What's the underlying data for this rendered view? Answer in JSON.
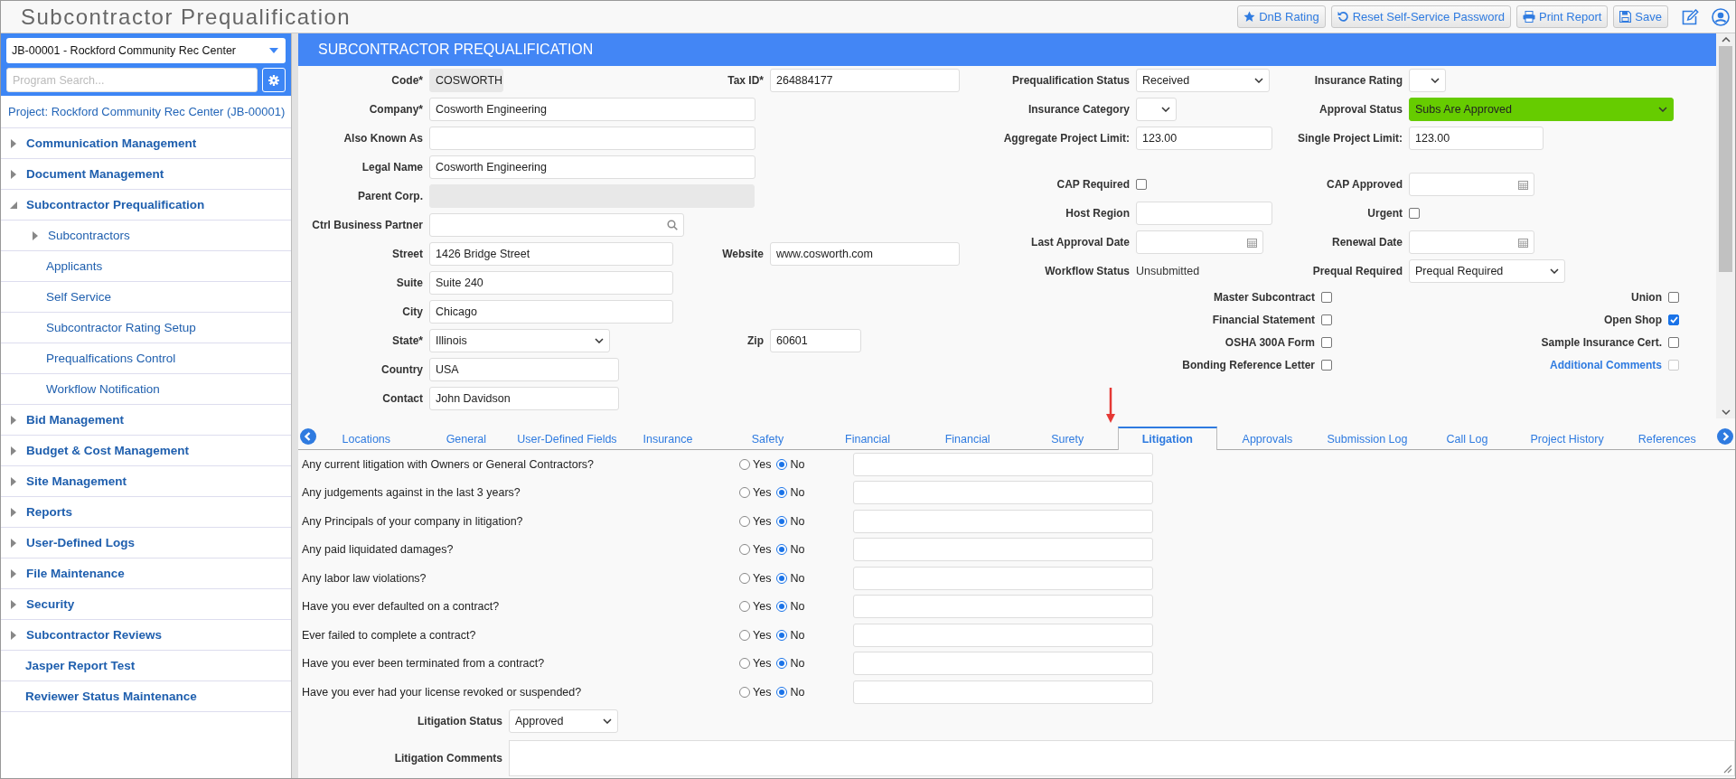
{
  "header": {
    "title": "Subcontractor Prequalification",
    "buttons": [
      {
        "label": "DnB Rating",
        "kind": "star"
      },
      {
        "label": "Reset Self-Service Password",
        "kind": "reset"
      },
      {
        "label": "Print Report",
        "kind": "print"
      },
      {
        "label": "Save",
        "kind": "save"
      }
    ],
    "tools": [
      {
        "kind": "edit"
      },
      {
        "kind": "user"
      }
    ]
  },
  "sidebar": {
    "project_select": "JB-00001 - Rockford Community Rec Center",
    "search": {
      "placeholder": "Program Search..."
    },
    "project_link": "Project: Rockford Community Rec Center (JB-00001)",
    "items": [
      {
        "label": "Communication Management",
        "kind": "group",
        "expanded": false
      },
      {
        "label": "Document Management",
        "kind": "group",
        "expanded": false
      },
      {
        "label": "Subcontractor Prequalification",
        "kind": "group",
        "expanded": true,
        "children": [
          {
            "label": "Subcontractors",
            "kind": "group",
            "expanded": false
          },
          {
            "label": "Applicants",
            "kind": "link"
          },
          {
            "label": "Self Service",
            "kind": "link"
          },
          {
            "label": "Subcontractor Rating Setup",
            "kind": "link"
          },
          {
            "label": "Prequalfications Control",
            "kind": "link"
          },
          {
            "label": "Workflow Notification",
            "kind": "link"
          }
        ]
      },
      {
        "label": "Bid Management",
        "kind": "group",
        "expanded": false
      },
      {
        "label": "Budget & Cost Management",
        "kind": "group",
        "expanded": false
      },
      {
        "label": "Site Management",
        "kind": "group",
        "expanded": false
      },
      {
        "label": "Reports",
        "kind": "group",
        "expanded": false
      },
      {
        "label": "User-Defined Logs",
        "kind": "group",
        "expanded": false
      },
      {
        "label": "File Maintenance",
        "kind": "group",
        "expanded": false
      },
      {
        "label": "Security",
        "kind": "group",
        "expanded": false
      },
      {
        "label": "Subcontractor Reviews",
        "kind": "group",
        "expanded": false
      },
      {
        "label": "Jasper Report Test",
        "kind": "link"
      },
      {
        "label": "Reviewer Status Maintenance",
        "kind": "link"
      }
    ]
  },
  "panel": {
    "title": "SUBCONTRACTOR PREQUALIFICATION",
    "left_rows": [
      [
        {
          "label": "Code*",
          "kind": "readonly",
          "value": "COSWORTH"
        },
        {
          "label": "Tax ID*",
          "kind": "text",
          "value": "264884177"
        }
      ],
      [
        {
          "label": "Company*",
          "kind": "text",
          "value": "Cosworth Engineering"
        }
      ],
      [
        {
          "label": "Also Known As",
          "kind": "text"
        }
      ],
      [
        {
          "label": "Legal Name",
          "kind": "text",
          "value": "Cosworth Engineering"
        }
      ],
      [
        {
          "label": "Parent Corp.",
          "kind": "readonly"
        }
      ],
      [
        {
          "label": "Ctrl Business Partner",
          "kind": "lookup"
        }
      ],
      [
        {
          "label": "Street",
          "kind": "text",
          "value": "1426 Bridge Street"
        },
        {
          "label": "Website",
          "kind": "text",
          "value": "www.cosworth.com"
        }
      ],
      [
        {
          "label": "Suite",
          "kind": "text",
          "value": "Suite 240"
        }
      ],
      [
        {
          "label": "City",
          "kind": "text",
          "value": "Chicago"
        }
      ],
      [
        {
          "label": "State*",
          "kind": "select",
          "value": "Illinois"
        },
        {
          "label": "Zip",
          "kind": "text",
          "value": "60601"
        }
      ],
      [
        {
          "label": "Country",
          "kind": "text",
          "value": "USA"
        }
      ],
      [
        {
          "label": "Contact",
          "kind": "text",
          "value": "John Davidson"
        }
      ]
    ],
    "right_rows": [
      [
        {
          "label": "Prequalification Status",
          "kind": "select",
          "value": "Received"
        },
        {
          "label": "Insurance Rating",
          "kind": "select"
        }
      ],
      [
        {
          "label": "Insurance Category",
          "kind": "select"
        },
        {
          "label": "Approval Status",
          "kind": "select",
          "value": "Subs Are Approved",
          "color": "#66cc00"
        }
      ],
      [
        {
          "label": "Aggregate Project Limit:",
          "kind": "text",
          "value": "123.00"
        },
        {
          "label": "Single Project Limit:",
          "kind": "text",
          "value": "123.00"
        }
      ],
      [
        {
          "label": "CAP Required",
          "kind": "checkbox",
          "checked": false
        },
        {
          "label": "CAP Approved",
          "kind": "date"
        }
      ],
      [
        {
          "label": "Host Region",
          "kind": "text"
        },
        {
          "label": "Urgent",
          "kind": "checkbox",
          "checked": false
        }
      ],
      [
        {
          "label": "Last Approval Date",
          "kind": "date"
        },
        {
          "label": "Renewal Date",
          "kind": "date"
        }
      ],
      [
        {
          "label": "Workflow Status",
          "kind": "static",
          "value": "Unsubmitted"
        },
        {
          "label": "Prequal Required",
          "kind": "select",
          "value": "Prequal Required"
        }
      ]
    ],
    "checkbox_rows": [
      [
        {
          "label": "Master Subcontract",
          "checked": false
        },
        {
          "label": "Union",
          "checked": false
        }
      ],
      [
        {
          "label": "Financial Statement",
          "checked": false
        },
        {
          "label": "Open Shop",
          "checked": true
        }
      ],
      [
        {
          "label": "OSHA 300A Form",
          "checked": false
        },
        {
          "label": "Sample Insurance Cert.",
          "checked": false
        }
      ],
      [
        {
          "label": "Bonding Reference Letter",
          "checked": false
        },
        {
          "label": "Additional Comments",
          "checked": false,
          "link": true,
          "disabled": true
        }
      ]
    ]
  },
  "tabs": [
    {
      "label": "Locations",
      "selected": false
    },
    {
      "label": "General",
      "selected": false
    },
    {
      "label": "User-Defined Fields",
      "selected": false
    },
    {
      "label": "Insurance",
      "selected": false
    },
    {
      "label": "Safety",
      "selected": false
    },
    {
      "label": "Financial",
      "selected": false
    },
    {
      "label": "Financial",
      "selected": false
    },
    {
      "label": "Surety",
      "selected": false
    },
    {
      "label": "Litigation",
      "selected": true
    },
    {
      "label": "Approvals",
      "selected": false
    },
    {
      "label": "Submission Log",
      "selected": false
    },
    {
      "label": "Call Log",
      "selected": false
    },
    {
      "label": "Project History",
      "selected": false
    },
    {
      "label": "References",
      "selected": false
    }
  ],
  "litigation": {
    "questions": [
      {
        "text": "Any current litigation with Owners or General Contractors?",
        "options": [
          {
            "label": "Yes",
            "selected": false
          },
          {
            "label": "No",
            "selected": true
          }
        ]
      },
      {
        "text": "Any judgements against in the last 3 years?",
        "options": [
          {
            "label": "Yes",
            "selected": false
          },
          {
            "label": "No",
            "selected": true
          }
        ]
      },
      {
        "text": "Any Principals of your company in litigation?",
        "options": [
          {
            "label": "Yes",
            "selected": false
          },
          {
            "label": "No",
            "selected": true
          }
        ]
      },
      {
        "text": "Any paid liquidated damages?",
        "options": [
          {
            "label": "Yes",
            "selected": false
          },
          {
            "label": "No",
            "selected": true
          }
        ]
      },
      {
        "text": "Any labor law violations?",
        "options": [
          {
            "label": "Yes",
            "selected": false
          },
          {
            "label": "No",
            "selected": true
          }
        ]
      },
      {
        "text": "Have you ever defaulted on a contract?",
        "options": [
          {
            "label": "Yes",
            "selected": false
          },
          {
            "label": "No",
            "selected": true
          }
        ]
      },
      {
        "text": "Ever failed to complete a contract?",
        "options": [
          {
            "label": "Yes",
            "selected": false
          },
          {
            "label": "No",
            "selected": true
          }
        ]
      },
      {
        "text": "Have you ever been terminated from a contract?",
        "options": [
          {
            "label": "Yes",
            "selected": false
          },
          {
            "label": "No",
            "selected": true
          }
        ]
      },
      {
        "text": "Have you ever had your license revoked or suspended?",
        "options": [
          {
            "label": "Yes",
            "selected": false
          },
          {
            "label": "No",
            "selected": true
          }
        ]
      }
    ],
    "status": {
      "label": "Litigation Status",
      "value": "Approved"
    },
    "comments": {
      "label": "Litigation Comments"
    }
  }
}
